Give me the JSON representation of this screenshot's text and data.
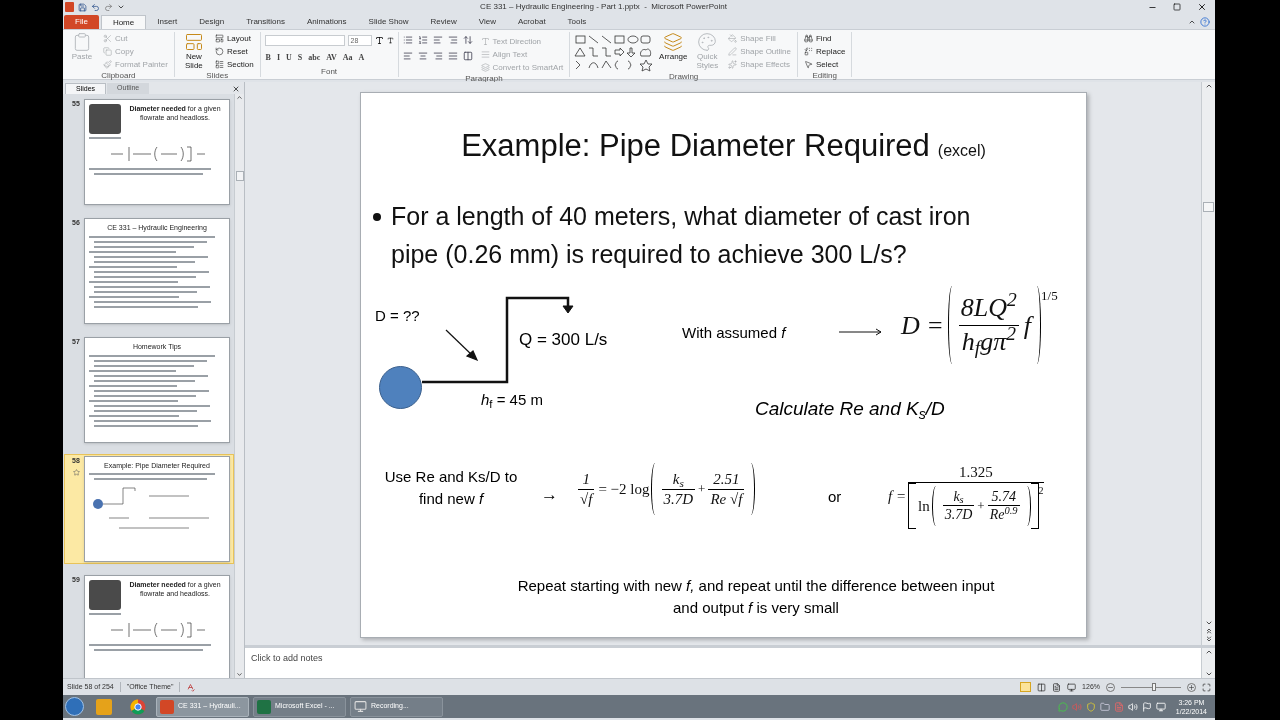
{
  "window": {
    "title": "CE 331 – Hydraulic Engineering - Part 1.pptx  -  Microsoft PowerPoint"
  },
  "tabs": [
    {
      "label": "File",
      "kind": "file",
      "selected": false
    },
    {
      "label": "Home",
      "kind": "tab",
      "selected": true
    },
    {
      "label": "Insert",
      "kind": "tab",
      "selected": false
    },
    {
      "label": "Design",
      "kind": "tab",
      "selected": false
    },
    {
      "label": "Transitions",
      "kind": "tab",
      "selected": false
    },
    {
      "label": "Animations",
      "kind": "tab",
      "selected": false
    },
    {
      "label": "Slide Show",
      "kind": "tab",
      "selected": false
    },
    {
      "label": "Review",
      "kind": "tab",
      "selected": false
    },
    {
      "label": "View",
      "kind": "tab",
      "selected": false
    },
    {
      "label": "Acrobat",
      "kind": "tab",
      "selected": false
    },
    {
      "label": "Tools",
      "kind": "tab",
      "selected": false
    }
  ],
  "ribbon": [
    {
      "kind": "clipboard",
      "label": "Clipboard",
      "large": [
        {
          "label": "Paste",
          "disabled": true
        }
      ],
      "items": [
        {
          "label": "Cut",
          "disabled": true
        },
        {
          "label": "Copy",
          "disabled": true
        },
        {
          "label": "Format Painter",
          "disabled": true
        }
      ]
    },
    {
      "kind": "slides",
      "label": "Slides",
      "large": [
        {
          "label": "New Slide",
          "disabled": false
        }
      ],
      "items": [
        {
          "label": "Layout",
          "disabled": false
        },
        {
          "label": "Reset",
          "disabled": false
        },
        {
          "label": "Section",
          "disabled": false
        }
      ]
    },
    {
      "kind": "font",
      "label": "Font",
      "font_size": "28",
      "buttons": [
        "B",
        "I",
        "U",
        "S",
        "abc",
        "AV",
        "Aa",
        "A"
      ]
    },
    {
      "kind": "paragraph",
      "label": "Paragraph",
      "items": [
        {
          "label": "Text Direction",
          "disabled": true
        },
        {
          "label": "Align Text",
          "disabled": true
        },
        {
          "label": "Convert to SmartArt",
          "disabled": true
        }
      ]
    },
    {
      "kind": "drawing",
      "label": "Drawing",
      "large": [
        {
          "label": "Arrange",
          "disabled": false
        },
        {
          "label": "Quick Styles",
          "disabled": true
        }
      ],
      "items": [
        {
          "label": "Shape Fill",
          "disabled": true
        },
        {
          "label": "Shape Outline",
          "disabled": true
        },
        {
          "label": "Shape Effects",
          "disabled": true
        }
      ]
    },
    {
      "kind": "editing",
      "label": "Editing",
      "items": [
        {
          "label": "Find",
          "disabled": false
        },
        {
          "label": "Replace",
          "disabled": false
        },
        {
          "label": "Select",
          "disabled": false
        }
      ]
    }
  ],
  "panel": {
    "tabs": [
      {
        "label": "Slides",
        "selected": true
      },
      {
        "label": "Outline",
        "selected": false
      }
    ],
    "thumbnails": [
      {
        "number": "55",
        "kind": "formula",
        "selected": false,
        "title": "**Diameter needed** for a given flowrate and headloss."
      },
      {
        "number": "56",
        "kind": "text",
        "selected": false,
        "title": "CE 331 – Hydraulic Engineering"
      },
      {
        "number": "57",
        "kind": "text",
        "selected": false,
        "title": "Homework Tips"
      },
      {
        "number": "58",
        "kind": "example",
        "selected": true,
        "title": "Example: Pipe Diameter Required"
      },
      {
        "number": "59",
        "kind": "formula",
        "selected": false,
        "title": "**Diameter needed** for a given flowrate and headloss."
      }
    ]
  },
  "slide": {
    "title": "Example: Pipe Diameter Required",
    "title_note": "(excel)",
    "bullet": "For a length of 40 meters, what diameter of cast iron pipe (0.26 mm) is required to achieve 300 L/s?",
    "diameter_label": "D = ??",
    "flow_label": "Q = 300 L/s",
    "head_label": "*h*$_{f}$ = 45 m",
    "assumed_label": "With assumed *f*",
    "eq1": {
      "lhs": "D =",
      "num": "8LQ$^{2}$",
      "den": "h$_{f}$gπ$^{2}$",
      "factor": "f",
      "exponent": "1/5"
    },
    "calculate_label": "Calculate Re and K$_{s}$/D",
    "use_label": "Use Re and Ks/D to find new *f*",
    "arrow": "→",
    "eq2": {
      "lhs_num": "1",
      "lhs_den": "√f",
      "op": "= −2 log",
      "terms": [
        {
          "num": "k$_{s}$",
          "den": "3.7D"
        },
        {
          "num": "2.51",
          "den": "Re √f"
        }
      ],
      "plus": "+"
    },
    "or_label": "or",
    "eq3": {
      "lhs": "f =",
      "num": "1.325",
      "prefix": "ln",
      "terms": [
        {
          "num": "k$_{s}$",
          "den": "3.7D"
        },
        {
          "num": "5.74",
          "den": "Re$^{0.9}$"
        }
      ],
      "plus": "+",
      "exponent": "2"
    },
    "repeat_label": "Repeat starting with new *f,* and repeat until the difference between input and output *f* is very small"
  },
  "notes": {
    "placeholder": "Click to add notes"
  },
  "status_bar": {
    "slide": "Slide 58 of 254",
    "theme": "\"Office Theme\"",
    "zoom": {
      "label": "126%",
      "level": 0.55
    }
  },
  "taskbar": {
    "apps": [
      {
        "kind": "powerpoint",
        "label": "CE 331 – Hydrauli...",
        "selected": true
      },
      {
        "kind": "excel",
        "label": "Microsoft Excel - ...",
        "selected": false
      },
      {
        "kind": "recording",
        "label": "Recording...",
        "selected": false
      }
    ],
    "time": "3:26 PM",
    "date": "1/22/2014"
  }
}
